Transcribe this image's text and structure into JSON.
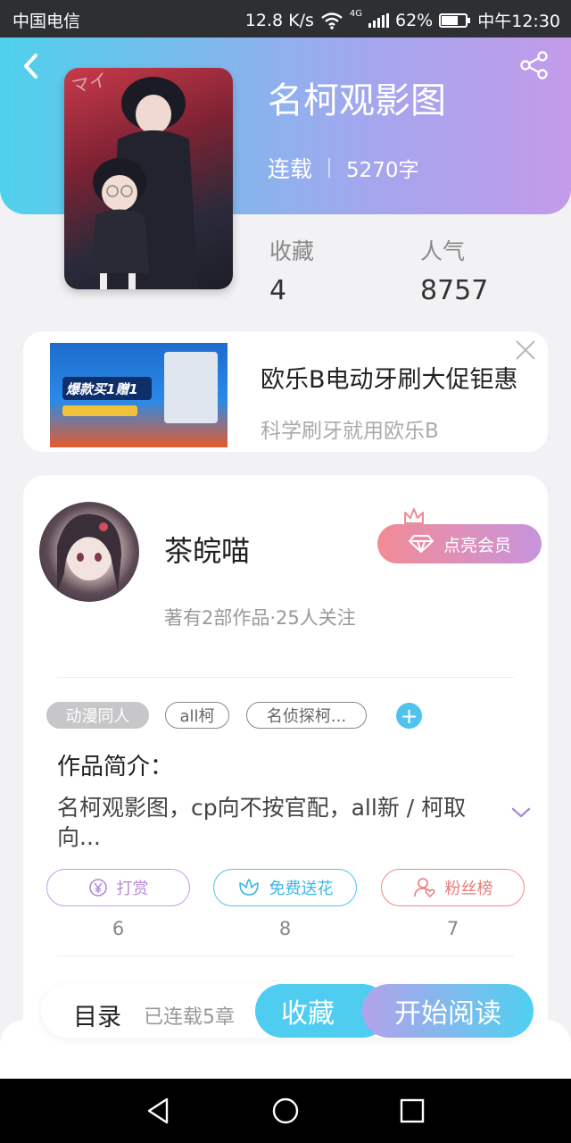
{
  "status_bar": {
    "carrier": "中国电信",
    "speed": "12.8 K/s",
    "network": "4G",
    "battery": "62%",
    "time": "中午12:30"
  },
  "book": {
    "title": "名柯观影图",
    "status": "连载",
    "word_count": "5270字",
    "favorites_label": "收藏",
    "favorites_value": "4",
    "popularity_label": "人气",
    "popularity_value": "8757"
  },
  "ad": {
    "title": "欧乐B电动牙刷大促钜惠",
    "subtitle": "科学刷牙就用欧乐B",
    "image_text": "爆款买1赠1"
  },
  "author": {
    "name": "茶皖喵",
    "info": "著有2部作品·25人关注",
    "vip_label": "点亮会员"
  },
  "tags": [
    "动漫同人",
    "all柯",
    "名侦探柯..."
  ],
  "intro": {
    "title": "作品简介：",
    "text": "名柯观影图，cp向不按官配，all新 / 柯取向..."
  },
  "actions": [
    {
      "label": "打赏",
      "count": "6"
    },
    {
      "label": "免费送花",
      "count": "8"
    },
    {
      "label": "粉丝榜",
      "count": "7"
    }
  ],
  "bottom": {
    "toc": "目录",
    "chapters": "已连载5章",
    "collect": "收藏",
    "read": "开始阅读"
  }
}
